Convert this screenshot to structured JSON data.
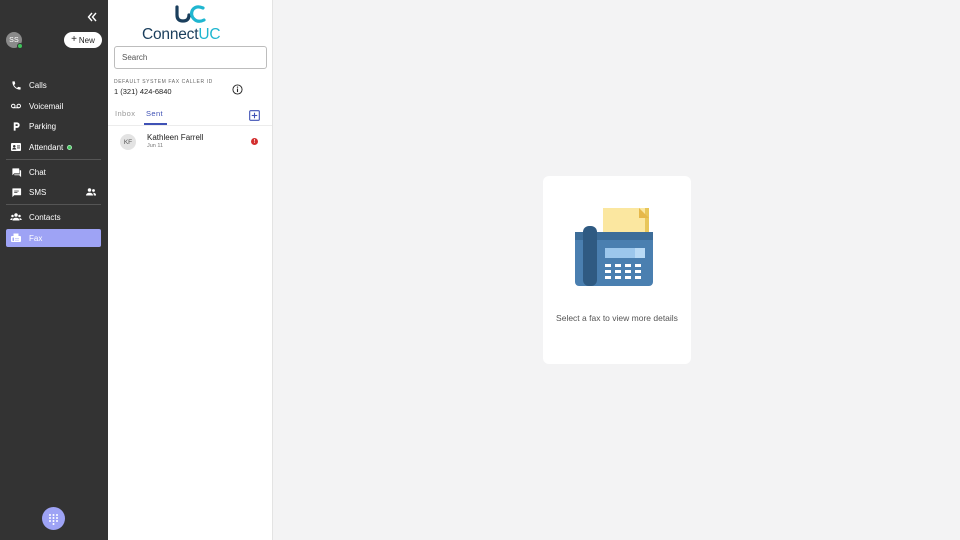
{
  "sidebar": {
    "user_initials": "SS",
    "new_button_label": "New",
    "items": [
      {
        "label": "Calls",
        "icon": "phone-icon"
      },
      {
        "label": "Voicemail",
        "icon": "voicemail-icon"
      },
      {
        "label": "Parking",
        "icon": "parking-icon"
      },
      {
        "label": "Attendant",
        "icon": "attendant-icon"
      },
      {
        "label": "Chat",
        "icon": "chat-icon"
      },
      {
        "label": "SMS",
        "icon": "sms-icon"
      },
      {
        "label": "Contacts",
        "icon": "contacts-icon"
      },
      {
        "label": "Fax",
        "icon": "fax-icon",
        "active": true
      }
    ]
  },
  "brand": {
    "logo_prefix": "Connect",
    "logo_suffix": "UC",
    "accent_color": "#1fb6d0",
    "dark_color": "#1a3e5c"
  },
  "fax_list": {
    "search_placeholder": "Search",
    "caller_id_label": "DEFAULT SYSTEM FAX CALLER ID",
    "caller_id_value": "1 (321) 424-6840",
    "tabs": [
      {
        "label": "Inbox",
        "selected": false
      },
      {
        "label": "Sent",
        "selected": true
      }
    ],
    "items": [
      {
        "initials": "KF",
        "name": "Kathleen Farrell",
        "date": "Jun 11",
        "status": "error"
      }
    ]
  },
  "main": {
    "empty_state_text": "Select a fax to view more details"
  },
  "colors": {
    "sidebar_bg": "#333333",
    "active_nav": "#9ea3f5",
    "tab_accent": "#3f51b5",
    "error": "#d32f2f",
    "online": "#3ec45a"
  }
}
